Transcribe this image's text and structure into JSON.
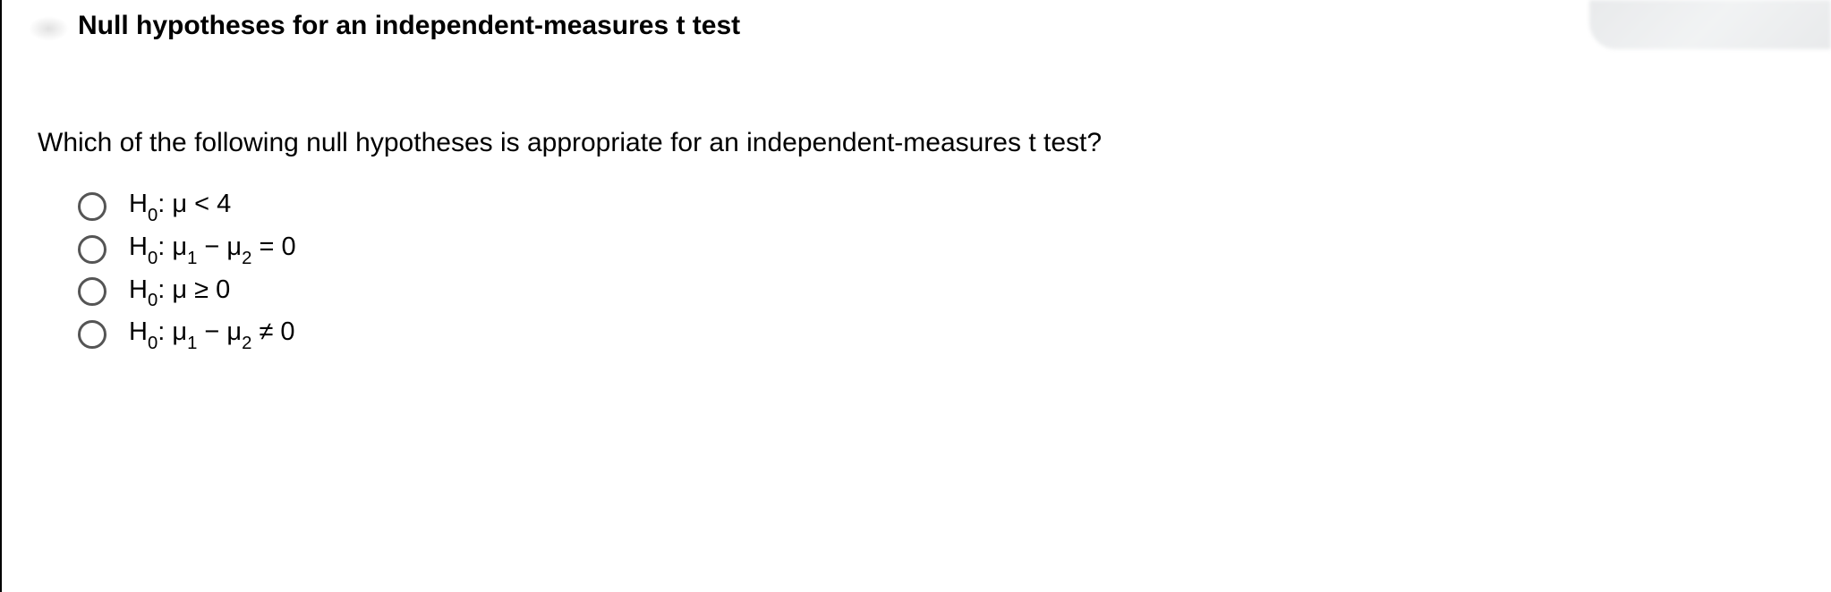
{
  "title": "Null hypotheses for an independent-measures t test",
  "question": "Which of the following null hypotheses is appropriate for an independent-measures t test?",
  "options": [
    {
      "prefix": "H",
      "prefixSub": "0",
      "after": ": μ < 4"
    },
    {
      "prefix": "H",
      "prefixSub": "0",
      "after": ": μ",
      "sub1": "1",
      "mid": " − μ",
      "sub2": "2",
      "tail": " = 0"
    },
    {
      "prefix": "H",
      "prefixSub": "0",
      "after": ": μ ≥ 0"
    },
    {
      "prefix": "H",
      "prefixSub": "0",
      "after": ": μ",
      "sub1": "1",
      "mid": " − μ",
      "sub2": "2",
      "tail": " ≠ 0"
    }
  ]
}
